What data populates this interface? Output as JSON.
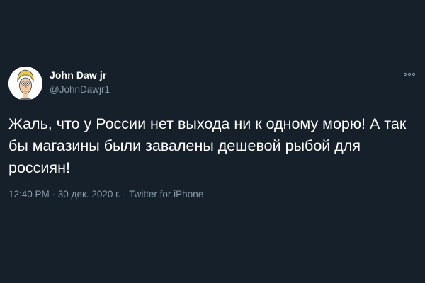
{
  "tweet": {
    "display_name": "John Daw jr",
    "handle": "@JohnDawjr1",
    "text": "Жаль, что у России нет выхода ни к одному морю! А так бы магазины были завалены дешевой рыбой для россиян!",
    "time": "12:40 PM",
    "separator": " · ",
    "date": "30 дек. 2020 г.",
    "source": "Twitter for iPhone",
    "more_icon": "more-dots-icon",
    "avatar_icon": "cartoon-avatar"
  },
  "colors": {
    "background": "#15202b",
    "primary_text": "#ffffff",
    "secondary_text": "#8899a6"
  }
}
